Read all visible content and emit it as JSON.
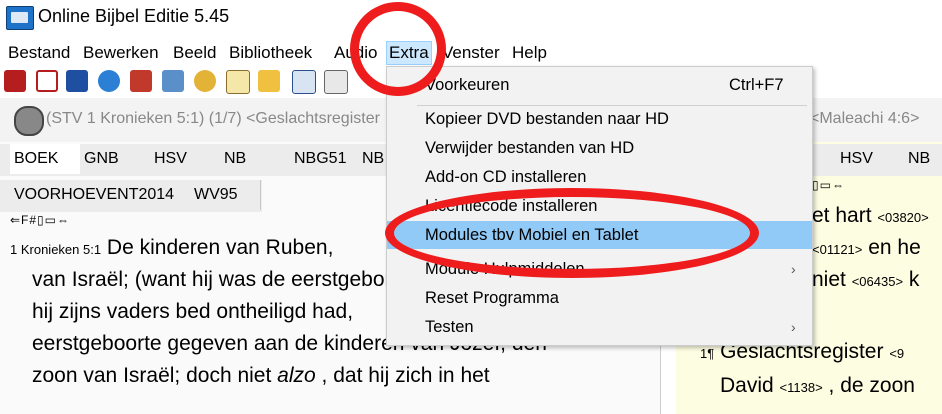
{
  "window": {
    "title": "Online Bijbel Editie 5.45"
  },
  "menubar": [
    "Bestand",
    "Bewerken",
    "Beeld",
    "Bibliotheek",
    "Audio",
    "Extra",
    "Venster",
    "Help"
  ],
  "dropdown": {
    "items": [
      {
        "label": "Voorkeuren",
        "shortcut": "Ctrl+F7"
      },
      {
        "label": "Kopieer DVD bestanden naar HD"
      },
      {
        "label": "Verwijder bestanden van HD"
      },
      {
        "label": "Add-on CD installeren"
      },
      {
        "label": "Licentiecode installeren"
      },
      {
        "label": "Modules tbv Mobiel en Tablet"
      },
      {
        "label": "Module Hulpmiddelen",
        "submenu": "›"
      },
      {
        "label": "Reset Programma"
      },
      {
        "label": "Testen",
        "submenu": "›"
      }
    ]
  },
  "left_pane": {
    "reference": "(STV 1 Kronieken 5:1) (1/7) <Geslachtsregister",
    "tabs_row1": [
      "BOEK",
      "GNB",
      "HSV",
      "NB",
      "NBG51",
      "NB"
    ],
    "tabs_row2": [
      "VOORHOEVENT2014",
      "WV95"
    ],
    "mini_tools": "⇐F#▯▭⇔",
    "verse_ref": "1 Kronieken 5:1",
    "lines": [
      "De kinderen van Ruben,",
      "van Israël; (want hij was de eerstgeboren,",
      "hij zijns vaders bed ontheiligd had,",
      "eerstgeboorte gegeven aan de kinderen van Jozef, den",
      "zoon van Israël; doch niet",
      "alzo",
      ", dat hij zich in het"
    ]
  },
  "right_pane": {
    "reference": "<Maleachi 4:6>",
    "tabs": [
      "HSV",
      "NB"
    ],
    "mini_tools": "▯▭⇔",
    "lines": [
      {
        "text": "et hart",
        "code": "<03820>"
      },
      {
        "text": "en he",
        "code": "<01121>"
      },
      {
        "text": "niet",
        "code": "<06435>",
        "after": "k"
      },
      {
        "verse": "1¶",
        "text": "Geslachtsregister",
        "code": "<9"
      },
      {
        "text": "David",
        "code": "<1138>",
        "after": ", de zoon"
      }
    ]
  },
  "colors": {
    "highlight": "#91c9f7",
    "menu_active": "#cce8ff",
    "annotation": "#ee1c1c",
    "right_pane_bg": "#fdfde2"
  }
}
